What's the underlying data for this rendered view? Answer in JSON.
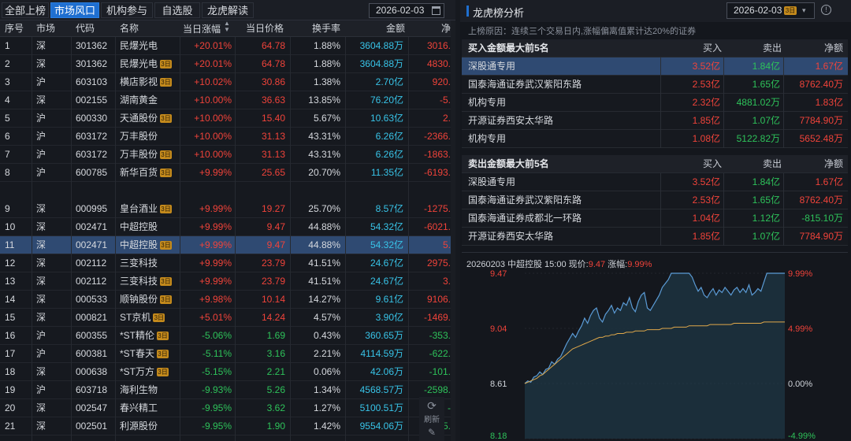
{
  "left": {
    "tabs": [
      {
        "label": "全部上榜",
        "active": false
      },
      {
        "label": "市场风口",
        "active": true
      },
      {
        "label": "机构参与",
        "active": false
      },
      {
        "label": "自选股",
        "active": false
      },
      {
        "label": "龙虎解读",
        "active": false
      }
    ],
    "date": "2026-02-03",
    "columns": [
      "序号",
      "市场",
      "代码",
      "名称",
      "当日涨幅",
      "当日价格",
      "换手率",
      "金额",
      "净"
    ],
    "badge_text": "3日",
    "rows": [
      {
        "no": "1",
        "mkt": "深",
        "code": "301362",
        "name": "民爆光电",
        "badge": false,
        "chg": "+20.01%",
        "price": "64.78",
        "turn": "1.88%",
        "amt": "3604.88万",
        "net": "3016.",
        "tone": "red",
        "selected": false
      },
      {
        "no": "2",
        "mkt": "深",
        "code": "301362",
        "name": "民爆光电",
        "badge": true,
        "chg": "+20.01%",
        "price": "64.78",
        "turn": "1.88%",
        "amt": "3604.88万",
        "net": "4830.",
        "tone": "red",
        "selected": false
      },
      {
        "no": "3",
        "mkt": "沪",
        "code": "603103",
        "name": "横店影视",
        "badge": true,
        "chg": "+10.02%",
        "price": "30.86",
        "turn": "1.38%",
        "amt": "2.70亿",
        "net": "920.",
        "tone": "red",
        "selected": false
      },
      {
        "no": "4",
        "mkt": "深",
        "code": "002155",
        "name": "湖南黄金",
        "badge": false,
        "chg": "+10.00%",
        "price": "36.63",
        "turn": "13.85%",
        "amt": "76.20亿",
        "net": "-5.",
        "tone": "red",
        "selected": false
      },
      {
        "no": "5",
        "mkt": "沪",
        "code": "600330",
        "name": "天通股份",
        "badge": true,
        "chg": "+10.00%",
        "price": "15.40",
        "turn": "5.67%",
        "amt": "10.63亿",
        "net": "2.",
        "tone": "red",
        "selected": false
      },
      {
        "no": "6",
        "mkt": "沪",
        "code": "603172",
        "name": "万丰股份",
        "badge": false,
        "chg": "+10.00%",
        "price": "31.13",
        "turn": "43.31%",
        "amt": "6.26亿",
        "net": "-2366.",
        "tone": "red",
        "selected": false
      },
      {
        "no": "7",
        "mkt": "沪",
        "code": "603172",
        "name": "万丰股份",
        "badge": true,
        "chg": "+10.00%",
        "price": "31.13",
        "turn": "43.31%",
        "amt": "6.26亿",
        "net": "-1863.",
        "tone": "red",
        "selected": false
      },
      {
        "no": "8",
        "mkt": "沪",
        "code": "600785",
        "name": "新华百货",
        "badge": true,
        "chg": "+9.99%",
        "price": "25.65",
        "turn": "20.70%",
        "amt": "11.35亿",
        "net": "-6193.",
        "tone": "red",
        "selected": false
      },
      {
        "no": "9",
        "mkt": "深",
        "code": "000995",
        "name": "皇台酒业",
        "badge": true,
        "chg": "+9.99%",
        "price": "19.27",
        "turn": "25.70%",
        "amt": "8.57亿",
        "net": "-1275.",
        "tone": "red",
        "selected": false
      },
      {
        "no": "10",
        "mkt": "深",
        "code": "002471",
        "name": "中超控股",
        "badge": false,
        "chg": "+9.99%",
        "price": "9.47",
        "turn": "44.88%",
        "amt": "54.32亿",
        "net": "-6021.",
        "tone": "red",
        "selected": false
      },
      {
        "no": "11",
        "mkt": "深",
        "code": "002471",
        "name": "中超控股",
        "badge": true,
        "chg": "+9.99%",
        "price": "9.47",
        "turn": "44.88%",
        "amt": "54.32亿",
        "net": "5.",
        "tone": "red",
        "selected": true
      },
      {
        "no": "12",
        "mkt": "深",
        "code": "002112",
        "name": "三变科技",
        "badge": false,
        "chg": "+9.99%",
        "price": "23.79",
        "turn": "41.51%",
        "amt": "24.67亿",
        "net": "2975.",
        "tone": "red",
        "selected": false
      },
      {
        "no": "13",
        "mkt": "深",
        "code": "002112",
        "name": "三变科技",
        "badge": true,
        "chg": "+9.99%",
        "price": "23.79",
        "turn": "41.51%",
        "amt": "24.67亿",
        "net": "3.",
        "tone": "red",
        "selected": false
      },
      {
        "no": "14",
        "mkt": "深",
        "code": "000533",
        "name": "顺钠股份",
        "badge": true,
        "chg": "+9.98%",
        "price": "10.14",
        "turn": "14.27%",
        "amt": "9.61亿",
        "net": "9106.",
        "tone": "red",
        "selected": false
      },
      {
        "no": "15",
        "mkt": "深",
        "code": "000821",
        "name": "ST京机",
        "badge": true,
        "chg": "+5.01%",
        "price": "14.24",
        "turn": "4.57%",
        "amt": "3.90亿",
        "net": "-1469.",
        "tone": "red",
        "selected": false
      },
      {
        "no": "16",
        "mkt": "沪",
        "code": "600355",
        "name": "*ST精伦",
        "badge": true,
        "chg": "-5.06%",
        "price": "1.69",
        "turn": "0.43%",
        "amt": "360.65万",
        "net": "-353.",
        "tone": "green",
        "selected": false
      },
      {
        "no": "17",
        "mkt": "沪",
        "code": "600381",
        "name": "*ST春天",
        "badge": true,
        "chg": "-5.11%",
        "price": "3.16",
        "turn": "2.21%",
        "amt": "4114.59万",
        "net": "-622.",
        "tone": "green",
        "selected": false
      },
      {
        "no": "18",
        "mkt": "深",
        "code": "000638",
        "name": "*ST万方",
        "badge": true,
        "chg": "-5.15%",
        "price": "2.21",
        "turn": "0.06%",
        "amt": "42.06万",
        "net": "-101.",
        "tone": "green",
        "selected": false
      },
      {
        "no": "19",
        "mkt": "沪",
        "code": "603718",
        "name": "海利生物",
        "badge": false,
        "chg": "-9.93%",
        "price": "5.26",
        "turn": "1.34%",
        "amt": "4568.57万",
        "net": "-2598.",
        "tone": "green",
        "selected": false
      },
      {
        "no": "20",
        "mkt": "深",
        "code": "002547",
        "name": "春兴精工",
        "badge": false,
        "chg": "-9.95%",
        "price": "3.62",
        "turn": "1.27%",
        "amt": "5100.51万",
        "net": "-",
        "tone": "green",
        "selected": false
      },
      {
        "no": "21",
        "mkt": "深",
        "code": "002501",
        "name": "利源股份",
        "badge": false,
        "chg": "-9.95%",
        "price": "1.90",
        "turn": "1.42%",
        "amt": "9554.06万",
        "net": "-1975.",
        "tone": "green",
        "selected": false
      }
    ],
    "refresh_label": "刷新"
  },
  "right": {
    "title": "龙虎榜分析",
    "date": "2026-02-03",
    "date_badge": "3日",
    "info_icon": "!",
    "reason": "上榜原因：连续三个交易日内,涨幅偏离值累计达20%的证券",
    "buy_table": {
      "title": "买入金额最大前5名",
      "cols": [
        "买入",
        "卖出",
        "净额"
      ],
      "rows": [
        {
          "name": "深股通专用",
          "buy": "3.52亿",
          "sell": "1.84亿",
          "net": "1.67亿",
          "net_tone": "red",
          "selected": true
        },
        {
          "name": "国泰海通证券武汉紫阳东路",
          "buy": "2.53亿",
          "sell": "1.65亿",
          "net": "8762.40万",
          "net_tone": "red",
          "selected": false
        },
        {
          "name": "机构专用",
          "buy": "2.32亿",
          "sell": "4881.02万",
          "net": "1.83亿",
          "net_tone": "red",
          "selected": false
        },
        {
          "name": "开源证券西安太华路",
          "buy": "1.85亿",
          "sell": "1.07亿",
          "net": "7784.90万",
          "net_tone": "red",
          "selected": false
        },
        {
          "name": "机构专用",
          "buy": "1.08亿",
          "sell": "5122.82万",
          "net": "5652.48万",
          "net_tone": "red",
          "selected": false
        }
      ]
    },
    "sell_table": {
      "title": "卖出金额最大前5名",
      "cols": [
        "买入",
        "卖出",
        "净额"
      ],
      "rows": [
        {
          "name": "深股通专用",
          "buy": "3.52亿",
          "sell": "1.84亿",
          "net": "1.67亿",
          "net_tone": "red",
          "selected": false
        },
        {
          "name": "国泰海通证券武汉紫阳东路",
          "buy": "2.53亿",
          "sell": "1.65亿",
          "net": "8762.40万",
          "net_tone": "red",
          "selected": false
        },
        {
          "name": "国泰海通证券成都北一环路",
          "buy": "1.04亿",
          "sell": "1.12亿",
          "net": "-815.10万",
          "net_tone": "green",
          "selected": false
        },
        {
          "name": "开源证券西安太华路",
          "buy": "1.85亿",
          "sell": "1.07亿",
          "net": "7784.90万",
          "net_tone": "red",
          "selected": false
        }
      ]
    },
    "chart_header": {
      "prefix": "20260203 中超控股 15:00 现价:",
      "price": "9.47",
      "chg_label": " 涨幅:",
      "chg": "9.99%"
    }
  },
  "colors": {
    "up": "#f0433a",
    "down": "#2ec25a",
    "accent": "#1f6fd0",
    "selected_row": "#2f4a72",
    "price_line": "#5b9bd5",
    "avg_line": "#e0a84a"
  },
  "chart_data": {
    "type": "line",
    "title": "",
    "xlabel": "",
    "ylabel": "",
    "y_left_ticks": [
      "9.47",
      "9.04",
      "8.61",
      "8.18"
    ],
    "y_right_ticks": [
      "9.99%",
      "4.99%",
      "0.00%",
      "-4.99%"
    ],
    "ylim": [
      8.18,
      9.47
    ],
    "prev_close": 8.61,
    "series": [
      {
        "values": [
          8.61,
          8.63,
          8.62,
          8.66,
          8.67,
          8.7,
          8.68,
          8.72,
          8.73,
          8.78,
          8.76,
          8.8,
          8.82,
          8.87,
          8.92,
          8.96,
          9.0,
          8.97,
          9.02,
          9.06,
          9.12,
          9.08,
          9.14,
          9.18,
          9.2,
          9.12,
          9.09,
          9.15,
          9.18,
          9.22,
          9.16,
          9.2,
          9.18,
          9.24,
          9.22,
          9.28,
          9.2,
          9.17,
          9.25,
          9.3,
          9.32,
          9.2,
          9.18,
          9.22,
          9.26,
          9.3,
          9.36,
          9.39,
          9.42,
          9.47,
          9.47,
          9.47,
          9.47,
          9.47,
          9.47,
          9.47,
          9.44,
          9.38,
          9.33,
          9.36,
          9.3,
          9.28,
          9.32,
          9.35,
          9.3,
          9.34,
          9.32,
          9.36,
          9.33,
          9.3,
          9.34,
          9.36,
          9.32,
          9.35,
          9.32,
          9.38,
          9.3,
          9.32,
          9.35,
          9.33,
          9.4,
          9.47,
          9.47,
          9.47,
          9.47,
          9.47,
          9.47,
          9.47
        ]
      },
      {
        "values": [
          8.61,
          8.62,
          8.63,
          8.64,
          8.65,
          8.67,
          8.68,
          8.7,
          8.72,
          8.74,
          8.76,
          8.78,
          8.8,
          8.82,
          8.84,
          8.86,
          8.88,
          8.89,
          8.9,
          8.91,
          8.92,
          8.93,
          8.94,
          8.95,
          8.96,
          8.97,
          8.97,
          8.98,
          8.98,
          8.99,
          8.99,
          9.0,
          9.0,
          9.0,
          9.01,
          9.01,
          9.01,
          9.02,
          9.02,
          9.02,
          9.02,
          9.03,
          9.03,
          9.03,
          9.03,
          9.03,
          9.04,
          9.04,
          9.04,
          9.04,
          9.05,
          9.05,
          9.05,
          9.05,
          9.05,
          9.06,
          9.06,
          9.06,
          9.06,
          9.06,
          9.06,
          9.06,
          9.07,
          9.07,
          9.07,
          9.07,
          9.07,
          9.07,
          9.07,
          9.07,
          9.08,
          9.08,
          9.08,
          9.08,
          9.08,
          9.08,
          9.08,
          9.08,
          9.08,
          9.08,
          9.09,
          9.09,
          9.09,
          9.09,
          9.09,
          9.09,
          9.09,
          9.09
        ]
      }
    ]
  }
}
